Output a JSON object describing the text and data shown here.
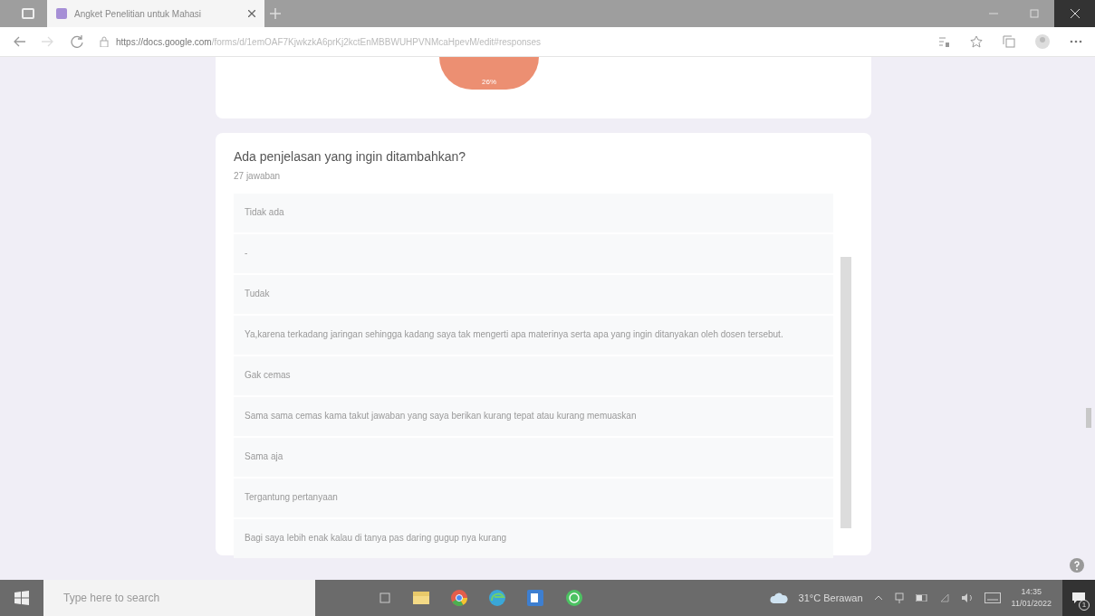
{
  "browser": {
    "tab": {
      "title": "Angket Penelitian untuk Mahasi",
      "selected": true
    },
    "url_host": "https://docs.google.com",
    "url_path": "/forms/d/1emOAF7KjwkzkA6prKj2kctEnMBBWUHPVNMcaHpevM/edit#responses"
  },
  "chart_card": {
    "pie_label": "26%"
  },
  "question": {
    "title": "Ada penjelasan yang ingin ditambahkan?",
    "count": "27 jawaban",
    "responses": [
      "Tidak ada",
      "-",
      "Tudak",
      "Ya,karena terkadang jaringan sehingga kadang saya tak mengerti apa materinya serta apa yang ingin ditanyakan oleh dosen tersebut.",
      "Gak cemas",
      "Sama sama cemas kama takut jawaban yang saya berikan kurang tepat atau kurang memuaskan",
      "Sama aja",
      "Tergantung pertanyaan",
      "Bagi saya lebih enak kalau di tanya pas daring gugup nya kurang"
    ]
  },
  "taskbar": {
    "search_placeholder": "Type here to search",
    "weather": "31°C  Berawan",
    "time": "14:35",
    "date": "11/01/2022",
    "notification_count": "1"
  }
}
